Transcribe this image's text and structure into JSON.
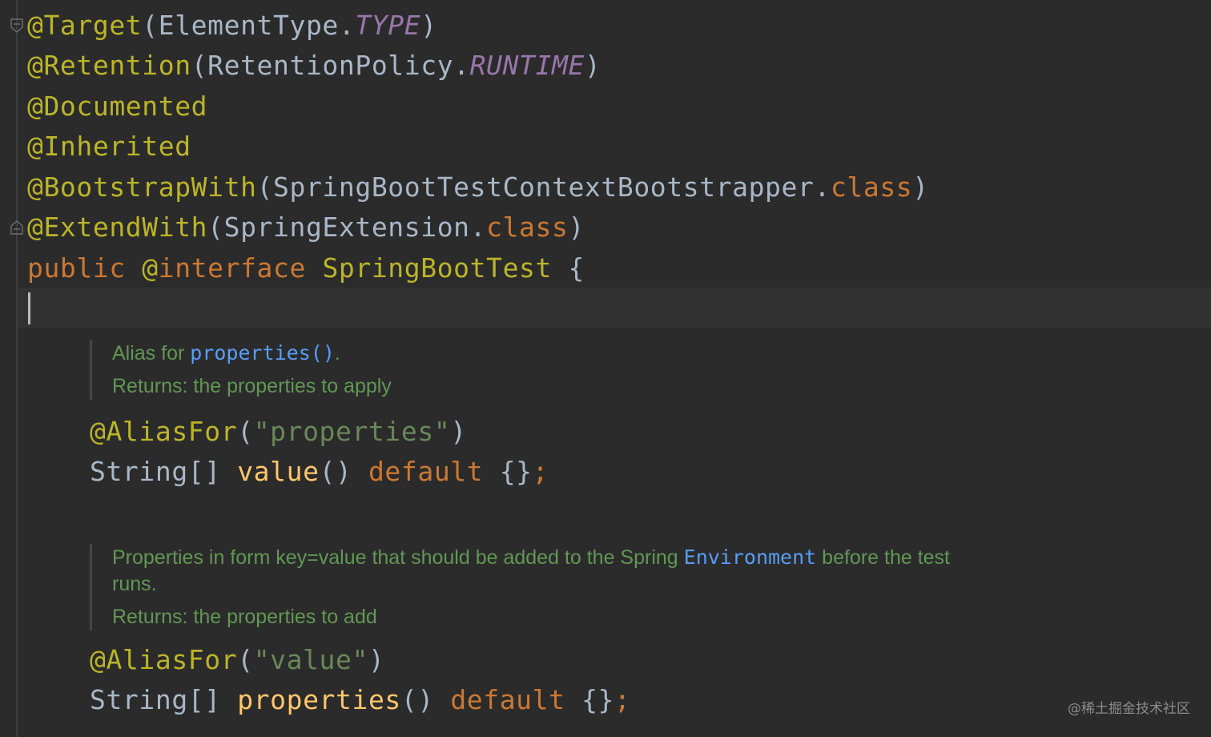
{
  "code": {
    "line1": {
      "annotation": "@Target",
      "open": "(",
      "cls": "ElementType",
      "dot": ".",
      "constant": "TYPE",
      "close": ")"
    },
    "line2": {
      "annotation": "@Retention",
      "open": "(",
      "cls": "RetentionPolicy",
      "dot": ".",
      "constant": "RUNTIME",
      "close": ")"
    },
    "line3": {
      "annotation": "@Documented"
    },
    "line4": {
      "annotation": "@Inherited"
    },
    "line5": {
      "annotation": "@BootstrapWith",
      "open": "(",
      "cls": "SpringBootTestContextBootstrapper",
      "dot": ".",
      "keyword": "class",
      "close": ")"
    },
    "line6": {
      "annotation": "@ExtendWith",
      "open": "(",
      "cls": "SpringExtension",
      "dot": ".",
      "keyword": "class",
      "close": ")"
    },
    "line7": {
      "modifier": "public",
      "at": "@",
      "keyword": "interface",
      "name": "SpringBootTest",
      "brace": "{"
    }
  },
  "doc1": {
    "alias_prefix": "Alias for ",
    "alias_link": "properties()",
    "alias_suffix": ".",
    "returns": "Returns: the properties to apply"
  },
  "member1": {
    "annotation": "@AliasFor",
    "open": "(",
    "string": "\"properties\"",
    "close": ")",
    "type": "String[]",
    "method": "value",
    "parens": "()",
    "keyword": "default",
    "value": "{}",
    "semi": ";"
  },
  "doc2": {
    "text_prefix": "Properties in form key=value that should be added to the Spring ",
    "link": "Environment",
    "text_suffix": " before the test",
    "text_wrap": "runs.",
    "returns": "Returns: the properties to add"
  },
  "member2": {
    "annotation": "@AliasFor",
    "open": "(",
    "string": "\"value\"",
    "close": ")",
    "type": "String[]",
    "method": "properties",
    "parens": "()",
    "keyword": "default",
    "value": "{}",
    "semi": ";"
  },
  "watermark": "@稀土掘金技术社区",
  "colors": {
    "background": "#2b2b2b",
    "annotation": "#bbb529",
    "keyword": "#cc7832",
    "constant": "#9876aa",
    "string": "#6a8759",
    "method": "#ffc66d",
    "doc_text": "#629755",
    "doc_link": "#589df6"
  }
}
